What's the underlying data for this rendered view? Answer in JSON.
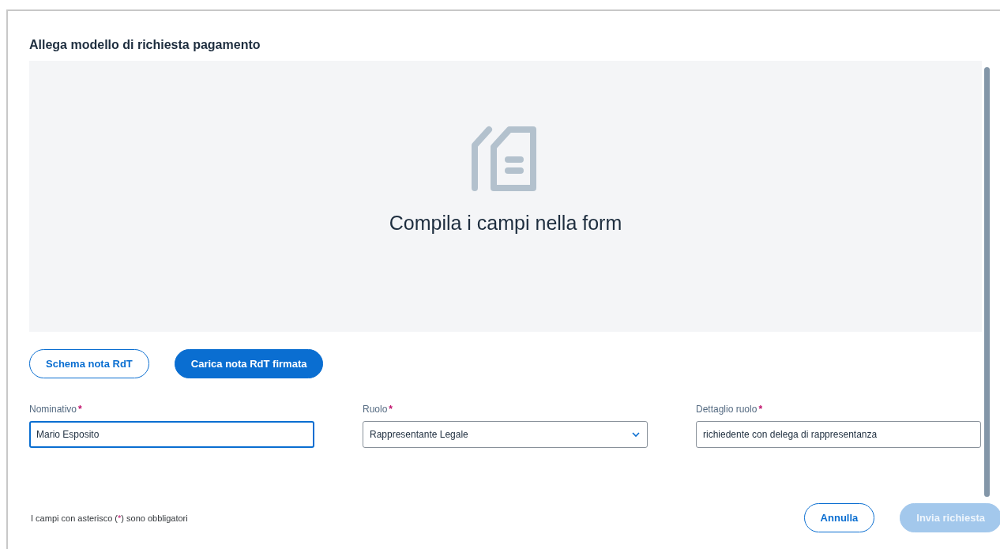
{
  "dialog": {
    "title": "Allega modello di richiesta pagamento"
  },
  "preview": {
    "message": "Compila i campi nella form"
  },
  "actions": [
    {
      "label": "Schema nota RdT",
      "kind": "outline"
    },
    {
      "label": "Carica nota RdT firmata",
      "kind": "primary"
    }
  ],
  "fields": [
    {
      "label": "Nominativo",
      "required_mark": "*",
      "kind": "text",
      "value": "Mario Esposito",
      "focused": true
    },
    {
      "label": "Ruolo",
      "required_mark": "*",
      "kind": "select",
      "value": "Rappresentante Legale",
      "focused": false
    },
    {
      "label": "Dettaglio ruolo",
      "required_mark": "*",
      "kind": "text",
      "value": "richiedente con delega di rappresentanza",
      "focused": false
    }
  ],
  "note": {
    "before": "I campi con asterisco (",
    "mark": "*",
    "after": ") sono obbligatori"
  },
  "footer_buttons": [
    {
      "label": "Annulla",
      "kind": "outline",
      "disabled": false
    },
    {
      "label": "Invia richiesta",
      "kind": "primary",
      "disabled": true
    }
  ]
}
